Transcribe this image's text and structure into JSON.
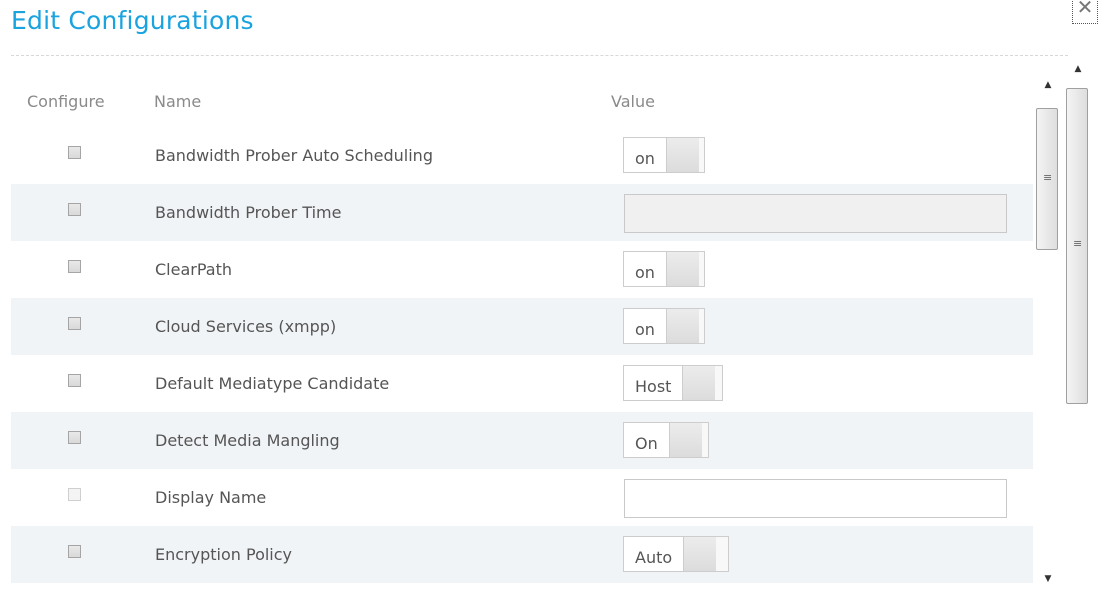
{
  "dialog": {
    "title": "Edit Configurations",
    "close_icon": "close-icon",
    "close_glyph": "✕"
  },
  "table": {
    "headers": {
      "configure": "Configure",
      "name": "Name",
      "value": "Value"
    },
    "rows": [
      {
        "name": "Bandwidth Prober Auto Scheduling",
        "value_type": "toggle",
        "value": "on",
        "enabled": true
      },
      {
        "name": "Bandwidth Prober Time",
        "value_type": "text",
        "value": "",
        "enabled": false
      },
      {
        "name": "ClearPath",
        "value_type": "toggle",
        "value": "on",
        "enabled": true
      },
      {
        "name": "Cloud Services (xmpp)",
        "value_type": "toggle",
        "value": "on",
        "enabled": true
      },
      {
        "name": "Default Mediatype Candidate",
        "value_type": "toggle",
        "value": "Host",
        "enabled": true
      },
      {
        "name": "Detect Media Mangling",
        "value_type": "toggle",
        "value": "On",
        "enabled": true
      },
      {
        "name": "Display Name",
        "value_type": "text",
        "value": "",
        "enabled": true
      },
      {
        "name": "Encryption Policy",
        "value_type": "toggle",
        "value": "Auto",
        "enabled": true
      }
    ]
  },
  "scrollbars": {
    "up_glyph": "▲",
    "down_glyph": "▼",
    "grip_glyph": "≡"
  }
}
